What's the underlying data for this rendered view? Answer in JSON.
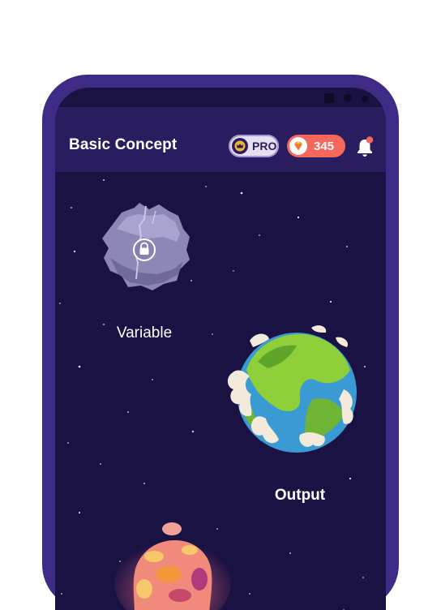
{
  "header": {
    "title": "Basic Concept",
    "pro_label": "PRO",
    "gem_count": "345"
  },
  "planets": [
    {
      "label": "Variable",
      "locked": true
    },
    {
      "label": "Output",
      "locked": false
    }
  ],
  "icons": {
    "pro": "crown-icon",
    "gems": "gem-icon",
    "notifications": "bell-icon",
    "lock": "lock-icon"
  },
  "colors": {
    "frame": "#3f2a86",
    "background": "#1b1244",
    "header": "#2a1d5f",
    "gem_pill": "#f4675a",
    "notification_dot": "#f4675a"
  }
}
